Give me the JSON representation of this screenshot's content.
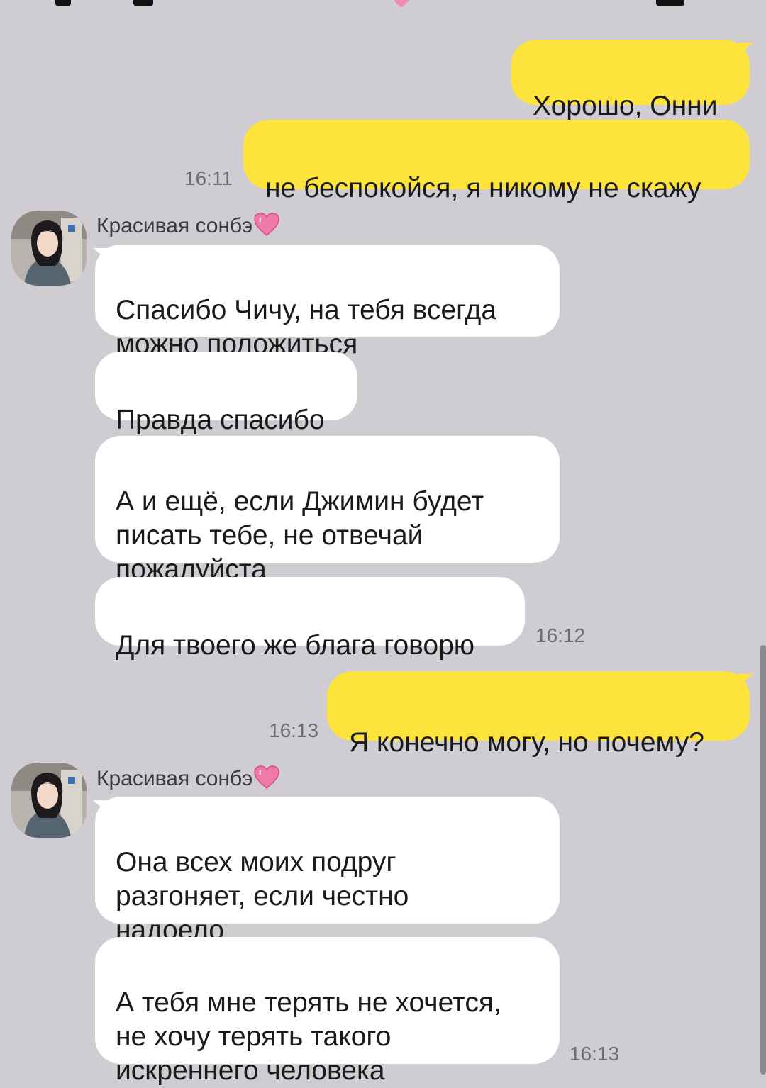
{
  "colors": {
    "background": "#cfcdd2",
    "outgoing_bubble": "#fee33c",
    "incoming_bubble": "#ffffff",
    "timestamp": "#6f6d72"
  },
  "messages": [
    {
      "dir": "out",
      "text": "Хорошо, Онни"
    },
    {
      "dir": "out",
      "text": "не беспокойся, я никому не скажу",
      "time": "16:11"
    },
    {
      "sender": "Красивая сонбэ",
      "sender_icon": "pink-heart-emoji"
    },
    {
      "dir": "in",
      "text": "Спасибо Чичу, на тебя всегда\nможно положиться"
    },
    {
      "dir": "in",
      "text": "Правда спасибо"
    },
    {
      "dir": "in",
      "text": "А и ещё, если Джимин будет\nписать тебе, не отвечай\nпожалуйста"
    },
    {
      "dir": "in",
      "text": "Для твоего же блага говорю",
      "time": "16:12"
    },
    {
      "dir": "out",
      "text": "Я конечно могу, но почему?",
      "time": "16:13"
    },
    {
      "sender": "Красивая сонбэ",
      "sender_icon": "pink-heart-emoji"
    },
    {
      "dir": "in",
      "text": "Она всех моих подруг\nразгоняет, если честно\nнадоело"
    },
    {
      "dir": "in",
      "text": "А тебя мне терять не хочется,\nне хочу терять такого\nискреннего человека",
      "time": "16:13"
    }
  ]
}
